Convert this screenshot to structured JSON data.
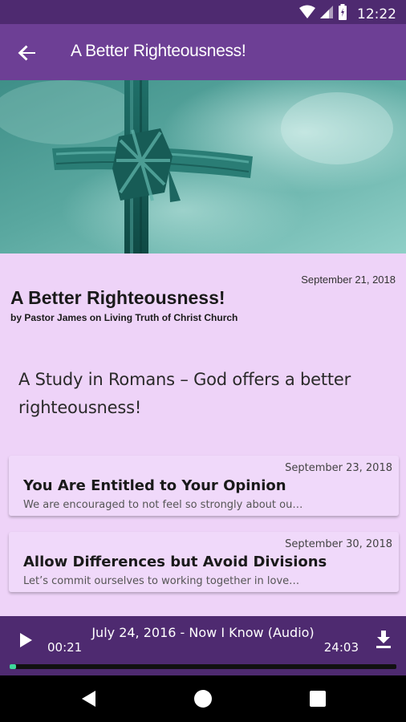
{
  "status_bar": {
    "time": "12:22"
  },
  "app_bar": {
    "title": "A Better Righteousness!"
  },
  "series": {
    "date": "September 21, 2018",
    "title": "A Better Righteousness!",
    "byline": "by Pastor James on Living Truth of Christ Church",
    "description": "A Study in Romans – God offers a better righteousness!"
  },
  "sermons": [
    {
      "date": "September 23, 2018",
      "title": "You Are Entitled to Your Opinion",
      "excerpt": "We are encouraged to not feel so strongly about ou…"
    },
    {
      "date": "September 30, 2018",
      "title": "Allow Differences but Avoid Divisions",
      "excerpt": "Let’s commit ourselves to working together in love…"
    }
  ],
  "player": {
    "title": "July 24, 2016 - Now I Know (Audio)",
    "elapsed": "00:21",
    "total": "24:03",
    "progress_fraction": 0.015
  },
  "colors": {
    "app_bar": "#6d3f95",
    "status_bar": "#4e2a70",
    "background": "#eed3f8",
    "card": "#f0d9fa",
    "progress": "#3ed89a"
  },
  "icons": {
    "back": "arrow-left-icon",
    "play": "play-icon",
    "download": "download-icon",
    "wifi": "wifi-icon",
    "signal": "signal-icon",
    "battery": "battery-icon",
    "nav_back": "triangle-back-icon",
    "nav_home": "circle-home-icon",
    "nav_recents": "square-recents-icon"
  }
}
